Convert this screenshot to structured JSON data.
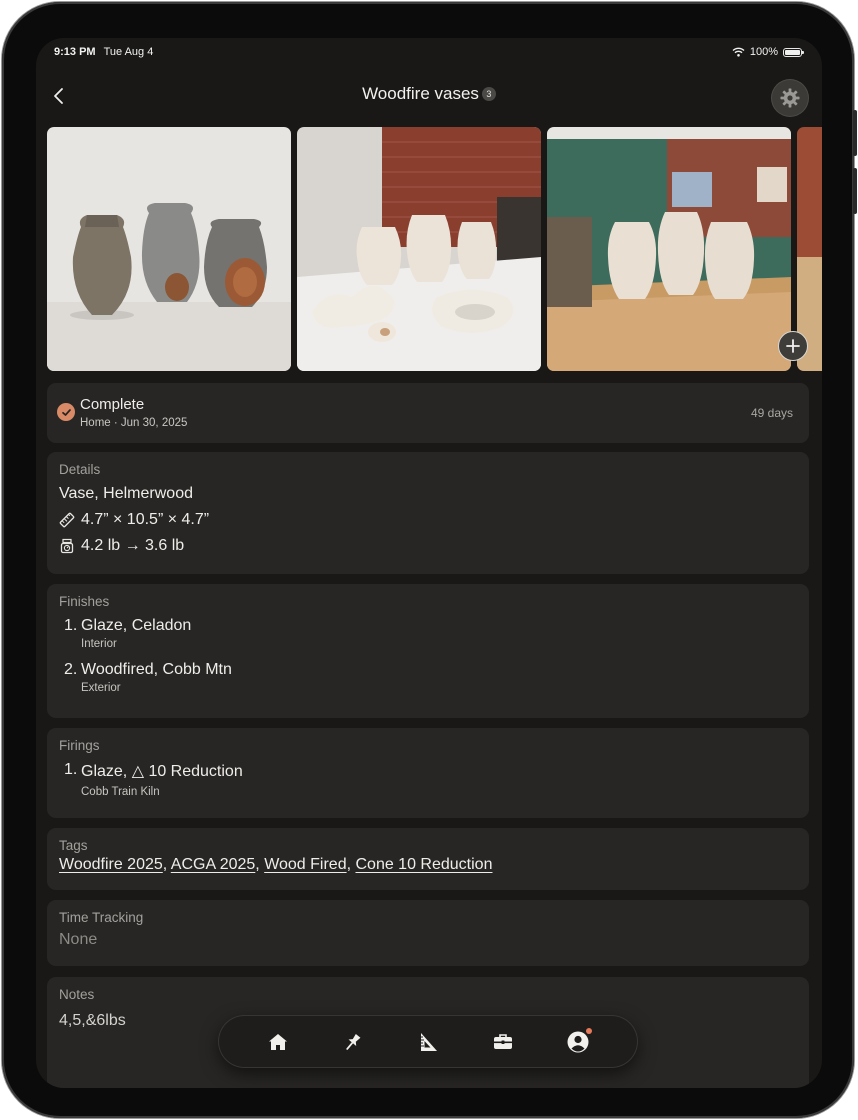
{
  "status_bar": {
    "time": "9:13 PM",
    "date": "Tue Aug 4",
    "battery": "100%"
  },
  "header": {
    "title": "Woodfire vases",
    "photo_count": "3"
  },
  "status": {
    "label": "Complete",
    "sub": "Home · Jun 30, 2025",
    "days": "49 days"
  },
  "details": {
    "label": "Details",
    "name": "Vase, Helmerwood",
    "dimensions": "4.7” × 10.5” × 4.7”",
    "weight": "4.2 lb → 3.6 lb"
  },
  "finishes": {
    "label": "Finishes",
    "items": [
      {
        "num": "1.",
        "name": "Glaze, Celadon",
        "sub": "Interior"
      },
      {
        "num": "2.",
        "name": "Woodfired, Cobb Mtn",
        "sub": "Exterior"
      }
    ]
  },
  "firings": {
    "label": "Firings",
    "items": [
      {
        "num": "1.",
        "name": "Glaze, △ 10 Reduction",
        "sub": "Cobb Train Kiln"
      }
    ]
  },
  "tags": {
    "label": "Tags",
    "items": [
      "Woodfire 2025",
      "ACGA 2025",
      "Wood Fired",
      "Cone 10 Reduction"
    ]
  },
  "time_tracking": {
    "label": "Time Tracking",
    "value": "None"
  },
  "notes": {
    "label": "Notes",
    "value": "4,5,&6lbs"
  },
  "icons": {
    "back": "chevron-left-icon",
    "settings": "gear-icon",
    "add": "plus-icon",
    "tabs": [
      "home-icon",
      "pin-icon",
      "triangle-ruler-icon",
      "toolbox-icon",
      "profile-icon"
    ]
  },
  "colors": {
    "accent": "#d98b68",
    "card": "#272624",
    "background": "#191816"
  }
}
